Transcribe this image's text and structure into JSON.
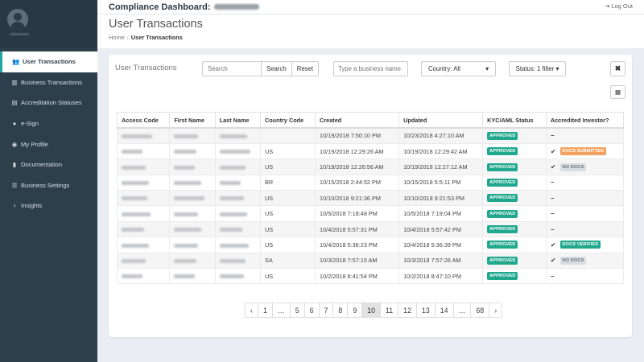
{
  "app": {
    "title": "Compliance Dashboard:",
    "logout_label": "Log Out"
  },
  "sidebar": {
    "items": [
      {
        "label": "User Transactions",
        "icon": "users-icon",
        "glyph": "👥"
      },
      {
        "label": "Business Transactions",
        "icon": "bar-chart-icon",
        "glyph": "▥"
      },
      {
        "label": "Accreditation Statuses",
        "icon": "id-card-icon",
        "glyph": "▤"
      },
      {
        "label": "e-Sign",
        "icon": "dot-icon",
        "glyph": "●"
      },
      {
        "label": "My Profile",
        "icon": "user-circle-icon",
        "glyph": "◉"
      },
      {
        "label": "Documentation",
        "icon": "book-icon",
        "glyph": "▮"
      },
      {
        "label": "Business Settings",
        "icon": "sliders-icon",
        "glyph": "☰"
      },
      {
        "label": "Insights",
        "icon": "lightbulb-icon",
        "glyph": "♀"
      }
    ]
  },
  "page": {
    "title": "User Transactions",
    "breadcrumb": {
      "home": "Home",
      "separator": "/",
      "current": "User Transactions"
    }
  },
  "card": {
    "title": "User Transactions",
    "search": {
      "placeholder": "Search",
      "search_label": "Search",
      "reset_label": "Reset"
    },
    "business_placeholder": "Type a business name",
    "country_label": "Country: All",
    "status_label": "Status: 1 filter ▾",
    "close_glyph": "✖",
    "columns_glyph": "▦"
  },
  "table": {
    "headers": [
      "Access Code",
      "First Name",
      "Last Name",
      "Country Code",
      "Created",
      "Updated",
      "KYC/AML Status",
      "Accredited Investor?"
    ],
    "rows": [
      {
        "country": "",
        "created": "10/19/2018 7:50:10 PM",
        "updated": "10/23/2018 4:27:10 AM",
        "kyc": "APPROVED",
        "accredited_check": false,
        "accredited_badge": "",
        "badge_type": ""
      },
      {
        "country": "US",
        "created": "10/19/2018 12:29:26 AM",
        "updated": "10/19/2018 12:29:42 AM",
        "kyc": "APPROVED",
        "accredited_check": true,
        "accredited_badge": "DOCS SUBMITTED",
        "badge_type": "submitted"
      },
      {
        "country": "US",
        "created": "10/19/2018 12:26:56 AM",
        "updated": "10/19/2018 12:27:12 AM",
        "kyc": "APPROVED",
        "accredited_check": true,
        "accredited_badge": "NO DOCS",
        "badge_type": "nodocs"
      },
      {
        "country": "BR",
        "created": "10/15/2018 2:44:52 PM",
        "updated": "10/15/2018 5:5:11 PM",
        "kyc": "APPROVED",
        "accredited_check": false,
        "accredited_badge": "",
        "badge_type": ""
      },
      {
        "country": "US",
        "created": "10/10/2018 9:21:36 PM",
        "updated": "10/10/2018 9:21:53 PM",
        "kyc": "APPROVED",
        "accredited_check": false,
        "accredited_badge": "",
        "badge_type": ""
      },
      {
        "country": "US",
        "created": "10/5/2018 7:18:48 PM",
        "updated": "10/5/2018 7:19:04 PM",
        "kyc": "APPROVED",
        "accredited_check": false,
        "accredited_badge": "",
        "badge_type": ""
      },
      {
        "country": "US",
        "created": "10/4/2018 5:57:31 PM",
        "updated": "10/4/2018 5:57:42 PM",
        "kyc": "APPROVED",
        "accredited_check": false,
        "accredited_badge": "",
        "badge_type": ""
      },
      {
        "country": "US",
        "created": "10/4/2018 5:36:23 PM",
        "updated": "10/4/2018 5:36:39 PM",
        "kyc": "APPROVED",
        "accredited_check": true,
        "accredited_badge": "DOCS VERIFIED",
        "badge_type": "verified"
      },
      {
        "country": "SA",
        "created": "10/3/2018 7:57:15 AM",
        "updated": "10/3/2018 7:57:26 AM",
        "kyc": "APPROVED",
        "accredited_check": true,
        "accredited_badge": "NO DOCS",
        "badge_type": "nodocs"
      },
      {
        "country": "US",
        "created": "10/2/2018 8:41:54 PM",
        "updated": "10/2/2018 8:47:10 PM",
        "kyc": "APPROVED",
        "accredited_check": false,
        "accredited_badge": "",
        "badge_type": ""
      }
    ]
  },
  "pagination": {
    "prev": "‹",
    "next": "›",
    "pages": [
      "1",
      "…",
      "5",
      "6",
      "7",
      "8",
      "9",
      "10",
      "11",
      "12",
      "13",
      "14",
      "…",
      "68"
    ],
    "current": "10"
  },
  "colors": {
    "sidebar": "#2e3f4c",
    "accent": "#1fa8a0",
    "approved": "#1fa88e",
    "submitted": "#f4a261",
    "nodocs": "#d8dde1"
  }
}
